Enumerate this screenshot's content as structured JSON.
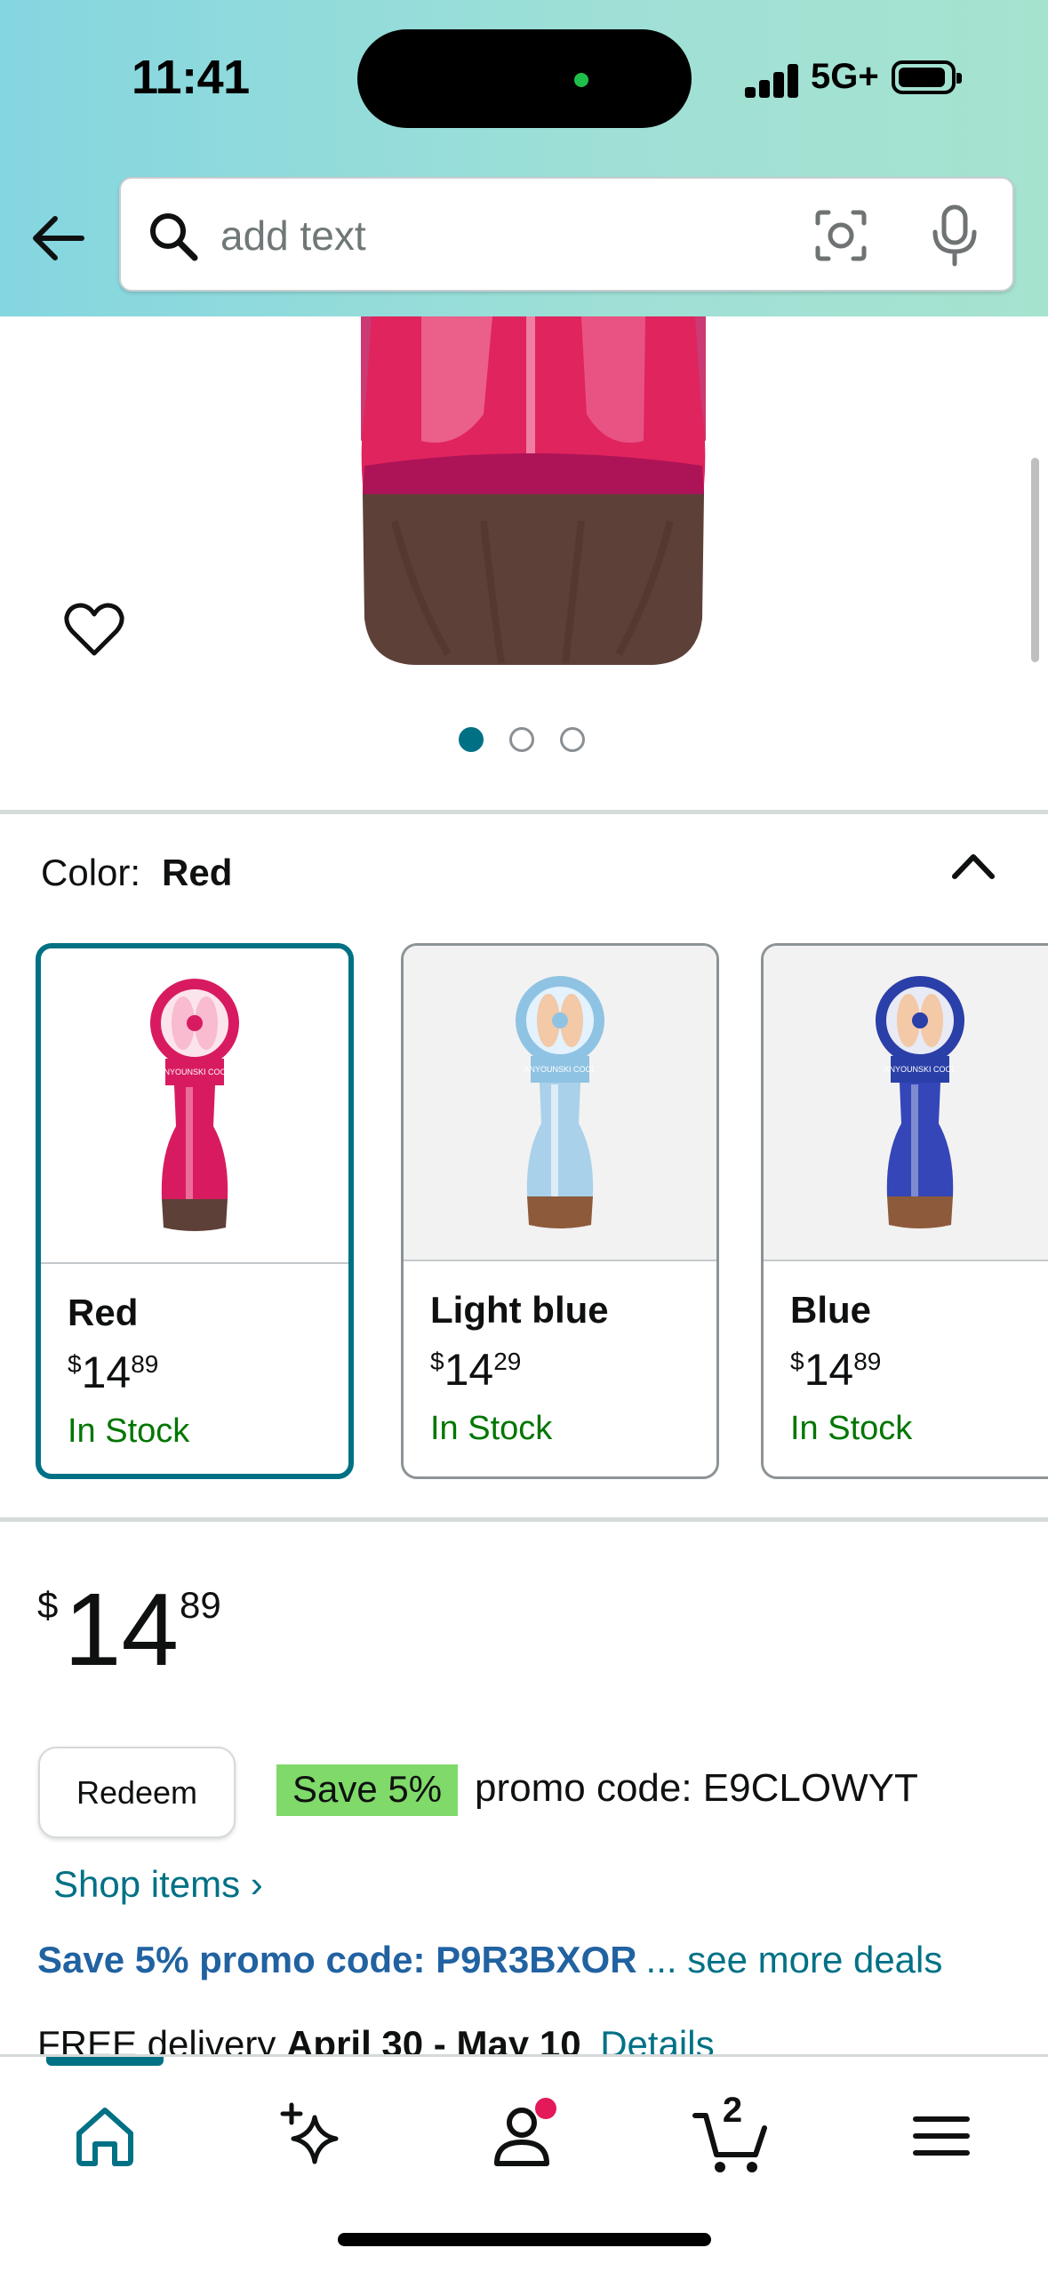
{
  "status_bar": {
    "time": "11:41",
    "network": "5G+"
  },
  "search": {
    "placeholder": "add text"
  },
  "icons": {
    "back": "arrow-left-icon",
    "search": "magnifier-icon",
    "lens": "camera-lens-icon",
    "mic": "microphone-icon",
    "wishlist": "heart-icon",
    "collapse": "chevron-up-icon",
    "home": "home-icon",
    "ai": "sparkle-icon",
    "account": "person-icon",
    "cart": "cart-icon",
    "menu": "hamburger-icon"
  },
  "gallery": {
    "image_count": 3,
    "active_index": 0
  },
  "variant": {
    "label": "Color:",
    "selected": "Red",
    "options": [
      {
        "name": "Red",
        "currency": "$",
        "whole": "14",
        "fraction": "89",
        "stock": "In Stock",
        "selected": true,
        "color": "#d81b60"
      },
      {
        "name": "Light blue",
        "currency": "$",
        "whole": "14",
        "fraction": "29",
        "stock": "In Stock",
        "selected": false,
        "color": "#9ecbe6"
      },
      {
        "name": "Blue",
        "currency": "$",
        "whole": "14",
        "fraction": "89",
        "stock": "In Stock",
        "selected": false,
        "color": "#2a3fa8"
      }
    ]
  },
  "price": {
    "currency": "$",
    "whole": "14",
    "fraction": "89"
  },
  "promo": {
    "redeem_label": "Redeem",
    "save_badge": "Save 5%",
    "code_text": "promo code: E9CLOWYT",
    "shop_items": "Shop items ›",
    "second_promo": "Save 5% promo code: P9R3BXOR",
    "see_more": "... see more deals"
  },
  "delivery": {
    "prefix": "FREE delivery",
    "dates": "April 30 - May 10",
    "details": "Details"
  },
  "nav": {
    "cart_count": "2",
    "active": "home"
  },
  "colors": {
    "accent": "#007185",
    "in_stock": "#007600",
    "promo_badge": "#7fda69",
    "link_bold": "#2162a1",
    "header_start": "#84d6e0",
    "header_end": "#a6e3cf"
  }
}
